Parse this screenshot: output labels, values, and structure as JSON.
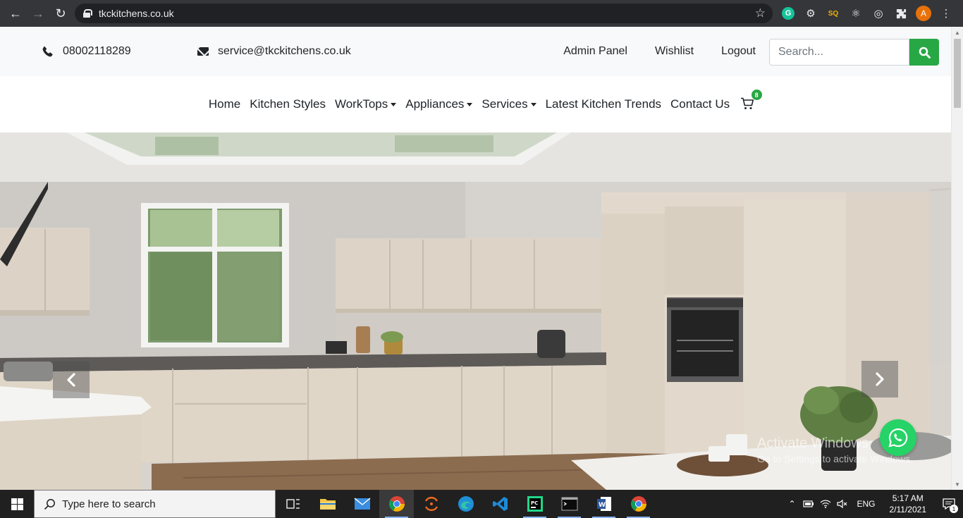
{
  "browser": {
    "url": "tkckitchens.co.uk",
    "profile_initial": "A",
    "extension_badge": "SQ"
  },
  "topbar": {
    "phone": "08002118289",
    "email": "service@tkckitchens.co.uk",
    "links": [
      "Admin Panel",
      "Wishlist",
      "Logout"
    ],
    "search_placeholder": "Search..."
  },
  "nav": {
    "items": [
      {
        "label": "Home",
        "dropdown": false
      },
      {
        "label": "Kitchen Styles",
        "dropdown": false
      },
      {
        "label": "WorkTops",
        "dropdown": true
      },
      {
        "label": "Appliances",
        "dropdown": true
      },
      {
        "label": "Services",
        "dropdown": true
      },
      {
        "label": "Latest Kitchen Trends",
        "dropdown": false
      },
      {
        "label": "Contact Us",
        "dropdown": false
      }
    ],
    "cart_count": "8"
  },
  "watermark": {
    "title": "Activate Windows",
    "subtitle": "Go to Settings to activate Windows."
  },
  "taskbar": {
    "search_text": "Type here to search",
    "language": "ENG",
    "time": "5:17 AM",
    "date": "2/11/2021",
    "notification_count": "1"
  },
  "colors": {
    "accent_green": "#28a745",
    "whatsapp_green": "#25d366",
    "topbar_bg": "#f8f9fa"
  }
}
